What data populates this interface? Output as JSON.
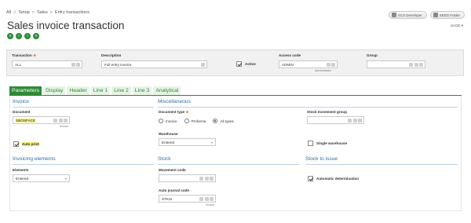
{
  "breadcrumb": [
    "All",
    "Setup",
    "Sales",
    "Entry transactions"
  ],
  "breadcrumb_sep": ">",
  "top_buttons": {
    "developer": "SCS Developer",
    "folder": "SEED Folder"
  },
  "folder_name": "SAGE",
  "page_title": "Sales invoice transaction",
  "header": {
    "transaction": {
      "label": "Transaction",
      "required": "★",
      "value": "ALL"
    },
    "description": {
      "label": "Description",
      "value": "Full entry invoice"
    },
    "active": {
      "label": "Active",
      "checked": true
    },
    "access_code": {
      "label": "Access code",
      "value": "ADMIN",
      "sub": "Administrator"
    },
    "group": {
      "label": "Group",
      "value": ""
    }
  },
  "tabs": [
    "Parameters",
    "Display",
    "Header",
    "Line 1",
    "Line 2",
    "Line 3",
    "Analytical"
  ],
  "active_tab": "Parameters",
  "invoice": {
    "title": "Invoice",
    "document_label": "Document",
    "document_value": "SBONFACE",
    "document_sub": "Invoice",
    "auto_print_label": "Auto print",
    "auto_print": true
  },
  "miscellaneous": {
    "title": "Miscellaneous",
    "doc_type_label": "Document type",
    "doc_type_required": "★",
    "doc_type_options": [
      "Invoice",
      "Proforma",
      "All types"
    ],
    "doc_type_selected": "All types",
    "warehouse_label": "Warehouse",
    "warehouse_value": "Entered"
  },
  "stock_movement_group": {
    "label": "Stock movement group",
    "value": ""
  },
  "single_warehouse": {
    "label": "Single warehouse",
    "checked": false
  },
  "invoicing_elements": {
    "title": "Invoicing elements",
    "elements_label": "Elements",
    "elements_value": "Entered"
  },
  "stock": {
    "title": "Stock",
    "movement_code_label": "Movement code",
    "movement_code_value": "",
    "auto_journal_label": "Auto journal code",
    "auto_journal_value": "STKSI",
    "auto_journal_sub": "Invoice"
  },
  "stock_to_issue": {
    "title": "Stock to issue",
    "auto_det_label": "Automatic determination",
    "auto_det": true
  },
  "colors": {
    "accent": "#2f8a35",
    "section": "#2e6fa8",
    "highlight": "#f6f17a",
    "required": "#e06b2a"
  }
}
